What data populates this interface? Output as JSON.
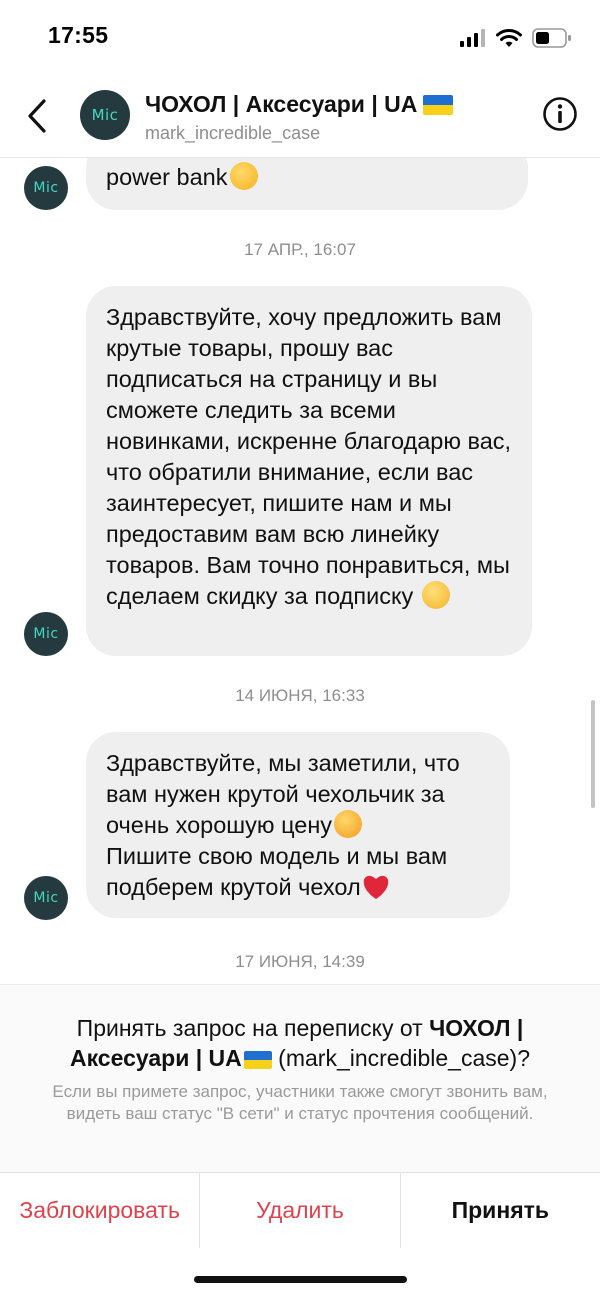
{
  "status_bar": {
    "time": "17:55"
  },
  "header": {
    "avatar_text": "Mic",
    "title": "ЧОХОЛ | Аксесуари | UA",
    "username": "mark_incredible_case"
  },
  "messages": [
    {
      "text": "power bank"
    },
    {
      "timestamp": "17 АПР., 16:07"
    },
    {
      "text": "Здравствуйте, хочу предложить вам крутые товары, прошу вас подписаться на страницу и вы сможете следить за всеми новинками, искренне благодарю вас, что обратили внимание, если вас заинтересует, пишите нам и мы предоставим вам всю линейку товаров. Вам точно понравиться, мы сделаем скидку за подписку"
    },
    {
      "timestamp": "14 ИЮНЯ, 16:33"
    },
    {
      "text_line1": "Здравствуйте, мы заметили, что вам нужен крутой чехольчик за очень хорошую цену",
      "text_line2": "Пишите свою модель и мы вам подберем крутой чехол"
    },
    {
      "timestamp": "17 ИЮНЯ, 14:39"
    }
  ],
  "request": {
    "prefix": "Принять запрос на переписку от ",
    "name": "ЧОХОЛ | Аксесуари | UA",
    "suffix": " (mark_incredible_case)?",
    "note": "Если вы примете запрос, участники также смогут звонить вам, видеть ваш статус \"В сети\" и статус прочтения сообщений."
  },
  "actions": {
    "block": "Заблокировать",
    "delete": "Удалить",
    "accept": "Принять"
  },
  "colors": {
    "accent_red": "#e0424d",
    "bubble_bg": "#efefef",
    "avatar_bg": "#243a3e",
    "avatar_text": "#45d6c2"
  }
}
